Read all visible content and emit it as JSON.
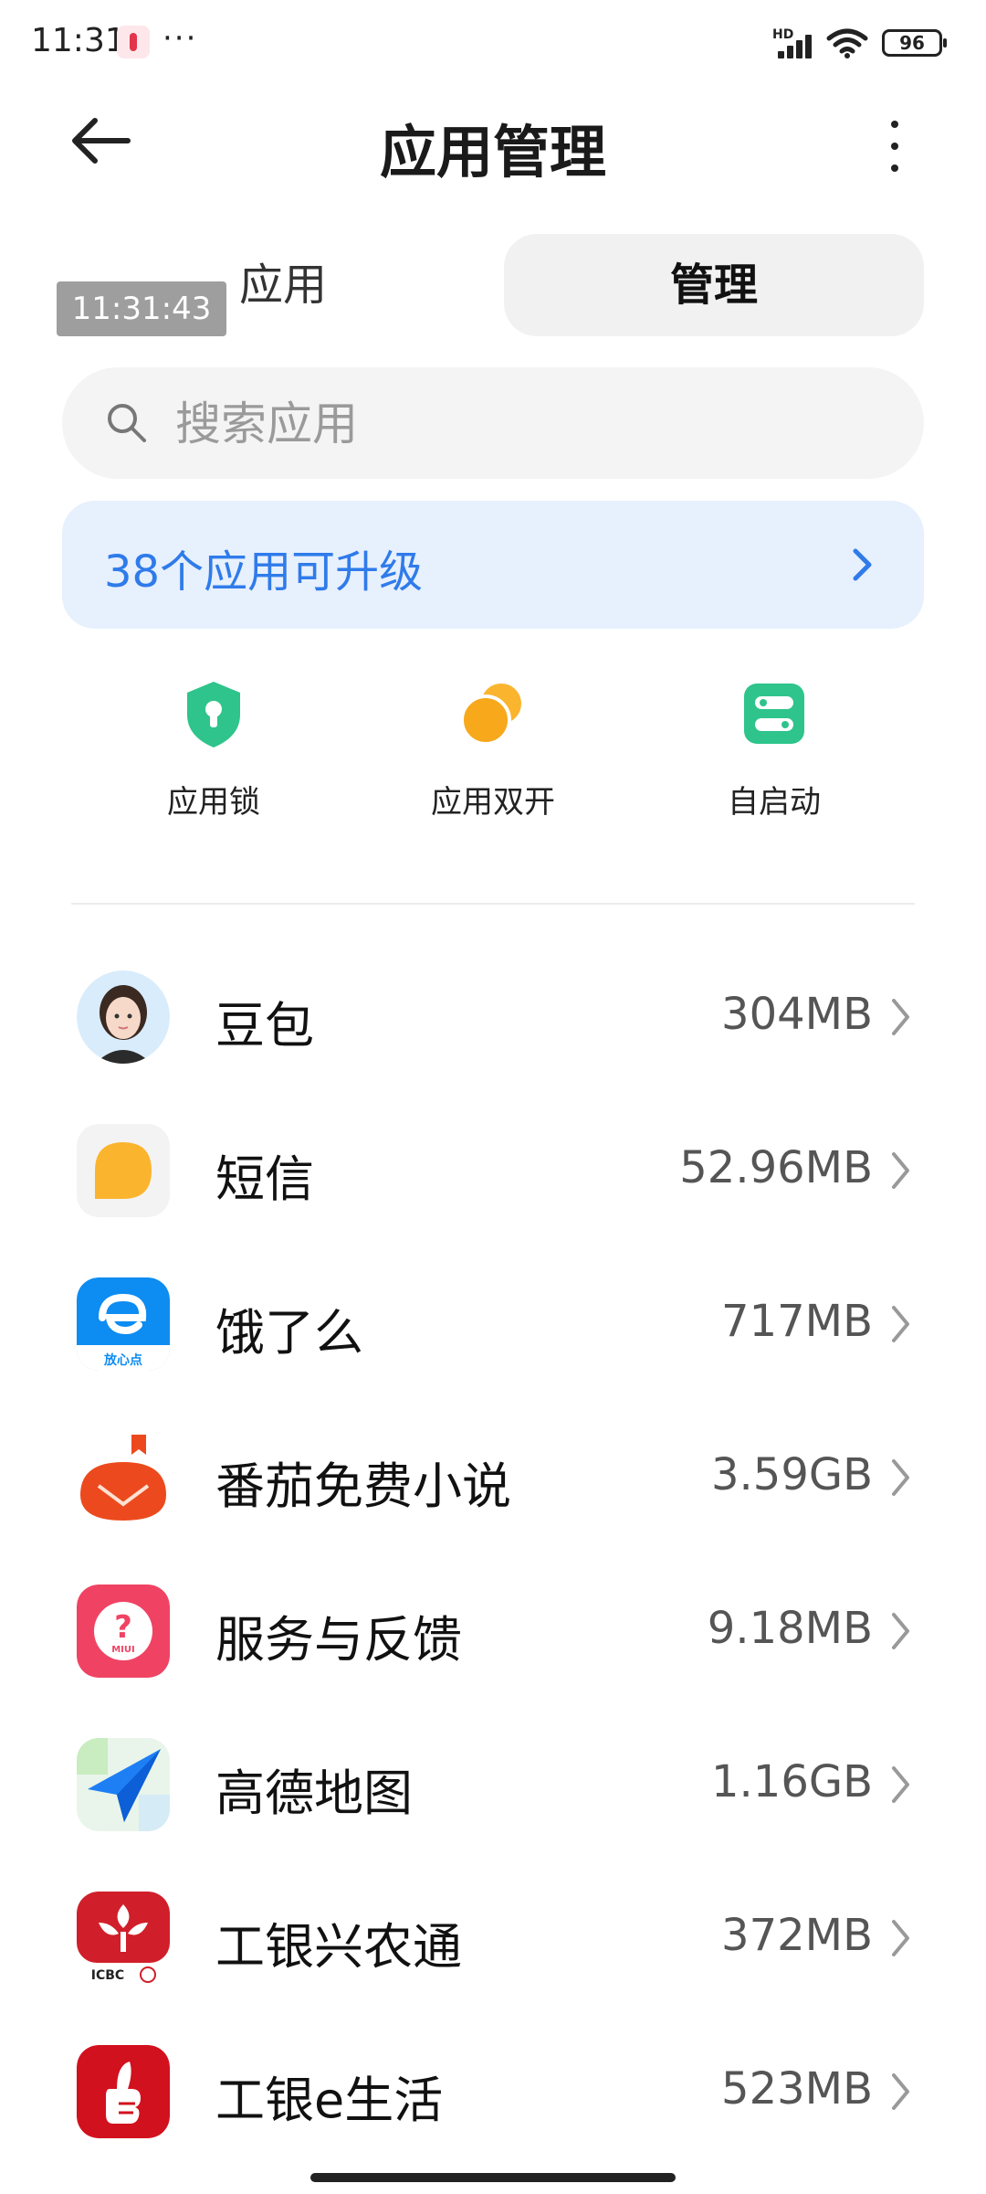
{
  "status_bar": {
    "time": "11:31",
    "dots": "···",
    "hd": "HD",
    "battery": "96"
  },
  "header": {
    "title": "应用管理"
  },
  "tabs": {
    "left": "应用",
    "right": "管理"
  },
  "overlay_timestamp": "11:31:43",
  "search": {
    "placeholder": "搜索应用"
  },
  "upgrade_banner": {
    "label": "38个应用可升级"
  },
  "quick_actions": [
    {
      "label": "应用锁",
      "icon": "shield-lock-icon",
      "color": "#2ec48b"
    },
    {
      "label": "应用双开",
      "icon": "dual-app-icon",
      "color": "#f7a81b"
    },
    {
      "label": "自启动",
      "icon": "autostart-toggle-icon",
      "color": "#2ec48b"
    }
  ],
  "apps": [
    {
      "name": "豆包",
      "size": "304MB",
      "icon": "doubao-avatar-icon"
    },
    {
      "name": "短信",
      "size": "52.96MB",
      "icon": "sms-icon"
    },
    {
      "name": "饿了么",
      "size": "717MB",
      "icon": "eleme-icon",
      "icon_text": "放心点"
    },
    {
      "name": "番茄免费小说",
      "size": "3.59GB",
      "icon": "tomato-novel-icon"
    },
    {
      "name": "服务与反馈",
      "size": "9.18MB",
      "icon": "service-feedback-icon",
      "icon_text": "MIUI"
    },
    {
      "name": "高德地图",
      "size": "1.16GB",
      "icon": "amap-icon"
    },
    {
      "name": "工银兴农通",
      "size": "372MB",
      "icon": "icbc-xingnong-icon",
      "icon_text": "ICBC"
    },
    {
      "name": "工银e生活",
      "size": "523MB",
      "icon": "icbc-elife-icon"
    }
  ]
}
